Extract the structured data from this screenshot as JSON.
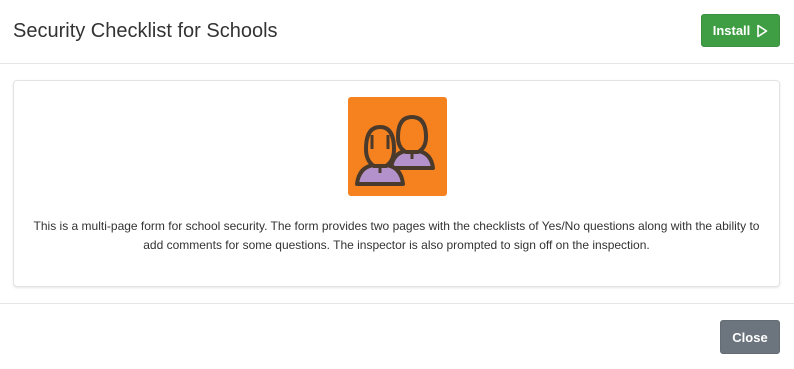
{
  "header": {
    "title": "Security Checklist for Schools",
    "install_label": "Install",
    "install_icon": "play-triangle-icon"
  },
  "card": {
    "app_icon": "people-icon",
    "icon_bg_color": "#f5821f",
    "description": "This is a multi-page form for school security. The form provides two pages with the checklists of Yes/No questions along with the ability to add comments for some questions. The inspector is also prompted to sign off on the inspection."
  },
  "footer": {
    "close_label": "Close"
  },
  "colors": {
    "install_button": "#3f9e44",
    "close_button": "#6c757d",
    "icon_person_fill": "#b392cc",
    "icon_outline": "#4a3a2c"
  }
}
